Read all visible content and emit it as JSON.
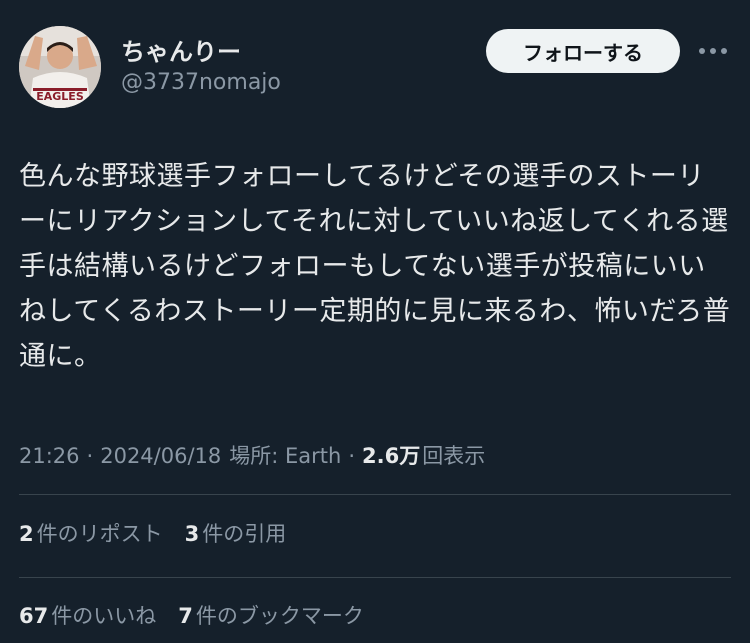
{
  "author": {
    "display_name": "ちゃんりー",
    "handle": "@3737nomajo"
  },
  "actions": {
    "follow_label": "フォローする",
    "more_icon": "more-horizontal-icon"
  },
  "tweet": {
    "text": "色んな野球選手フォローしてるけどその選手のストーリーにリアクションしてそれに対していいね返してくれる選手は結構いるけどフォローもしてない選手が投稿にいいねしてくるわストーリー定期的に見に来るわ、怖いだろ普通に。"
  },
  "meta": {
    "time": "21:26",
    "separator": "·",
    "date": "2024/06/18",
    "location": "場所: Earth",
    "views_count": "2.6万",
    "views_label": "回表示"
  },
  "stats": {
    "reposts_count": "2",
    "reposts_label": "件のリポスト",
    "quotes_count": "3",
    "quotes_label": "件の引用",
    "likes_count": "67",
    "likes_label": "件のいいね",
    "bookmarks_count": "7",
    "bookmarks_label": "件のブックマーク"
  },
  "colors": {
    "background": "#15202b",
    "text_primary": "#e7e9ea",
    "text_secondary": "#8b98a5",
    "divider": "#38444d",
    "button_bg": "#eff3f4"
  }
}
